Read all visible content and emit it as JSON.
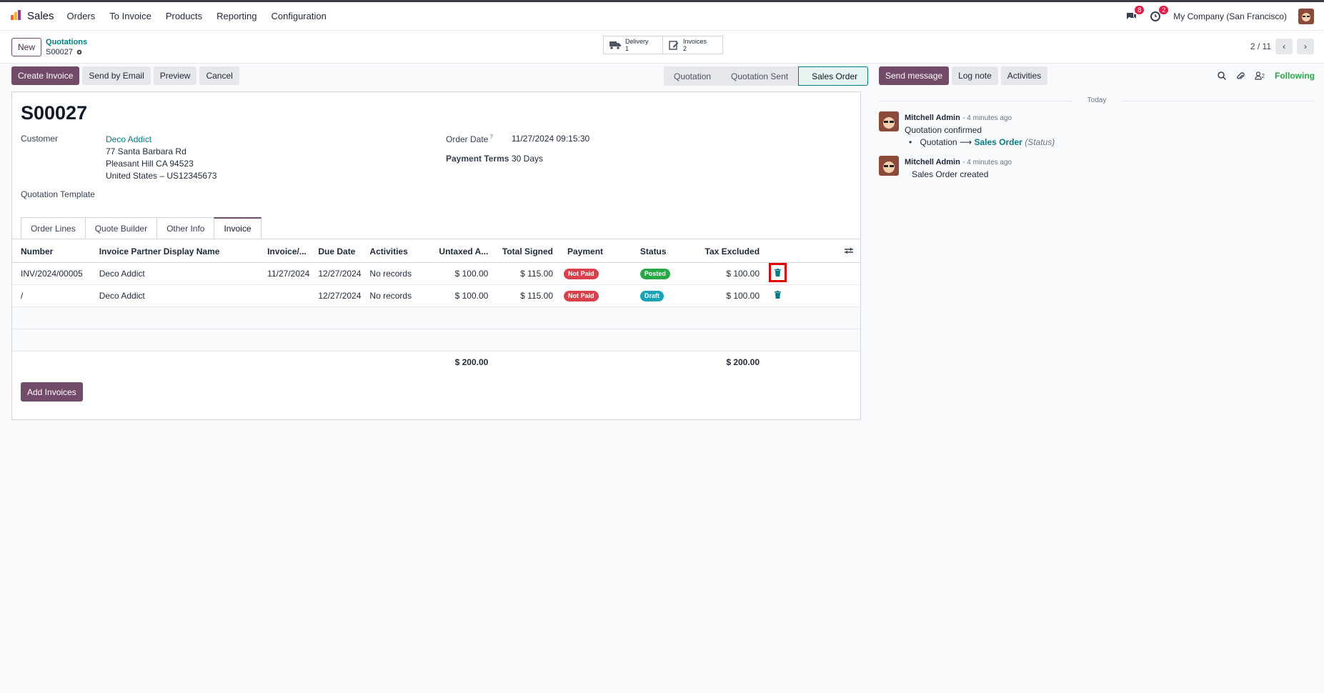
{
  "app": {
    "name": "Sales"
  },
  "nav": {
    "menu": [
      "Orders",
      "To Invoice",
      "Products",
      "Reporting",
      "Configuration"
    ],
    "messages_badge": "8",
    "activities_badge": "2",
    "company": "My Company (San Francisco)"
  },
  "control": {
    "new_label": "New",
    "breadcrumb_parent": "Quotations",
    "breadcrumb_current": "S00027",
    "delivery_label": "Delivery",
    "delivery_count": "1",
    "invoices_label": "Invoices",
    "invoices_count": "2",
    "pager": "2 / 11"
  },
  "actions": {
    "create_invoice": "Create Invoice",
    "send_email": "Send by Email",
    "preview": "Preview",
    "cancel": "Cancel"
  },
  "status": {
    "steps": [
      "Quotation",
      "Quotation Sent",
      "Sales Order"
    ],
    "active": "Sales Order"
  },
  "record": {
    "title": "S00027",
    "customer_label": "Customer",
    "customer_name": "Deco Addict",
    "address_line1": "77 Santa Barbara Rd",
    "address_line2": "Pleasant Hill CA 94523",
    "address_line3": "United States – US12345673",
    "template_label": "Quotation Template",
    "order_date_label": "Order Date",
    "order_date_help": "?",
    "order_date": "11/27/2024 09:15:30",
    "payment_terms_label": "Payment Terms",
    "payment_terms": "30 Days"
  },
  "tabs": [
    "Order Lines",
    "Quote Builder",
    "Other Info",
    "Invoice"
  ],
  "invoice_table": {
    "headers": [
      "Number",
      "Invoice Partner Display Name",
      "Invoice/...",
      "Due Date",
      "Activities",
      "Untaxed A...",
      "Total Signed",
      "Payment",
      "Status",
      "Tax Excluded"
    ],
    "rows": [
      {
        "number": "INV/2024/00005",
        "partner": "Deco Addict",
        "invoice_date": "11/27/2024",
        "due_date": "12/27/2024",
        "activities": "No records",
        "untaxed": "$ 100.00",
        "total": "$ 115.00",
        "payment": "Not Paid",
        "status": "Posted",
        "tax_excluded": "$ 100.00"
      },
      {
        "number": "/",
        "partner": "Deco Addict",
        "invoice_date": "",
        "due_date": "12/27/2024",
        "activities": "No records",
        "untaxed": "$ 100.00",
        "total": "$ 115.00",
        "payment": "Not Paid",
        "status": "Draft",
        "tax_excluded": "$ 100.00"
      }
    ],
    "total_untaxed": "$ 200.00",
    "total_tax_excluded": "$ 200.00",
    "add_label": "Add Invoices"
  },
  "chatter": {
    "send_message": "Send message",
    "log_note": "Log note",
    "activities": "Activities",
    "followers_count": "2",
    "following": "Following",
    "today": "Today",
    "messages": [
      {
        "author": "Mitchell Admin",
        "time": "- 4 minutes ago",
        "text": "Quotation confirmed",
        "tracking_from": "Quotation",
        "tracking_to": "Sales Order",
        "tracking_field": "(Status)"
      },
      {
        "author": "Mitchell Admin",
        "time": "- 4 minutes ago",
        "text": "Sales Order created"
      }
    ]
  },
  "colors": {
    "brand": "#714b67",
    "link": "#017e84",
    "success": "#28a745",
    "danger": "#d9404b",
    "info": "#17a2b8"
  }
}
